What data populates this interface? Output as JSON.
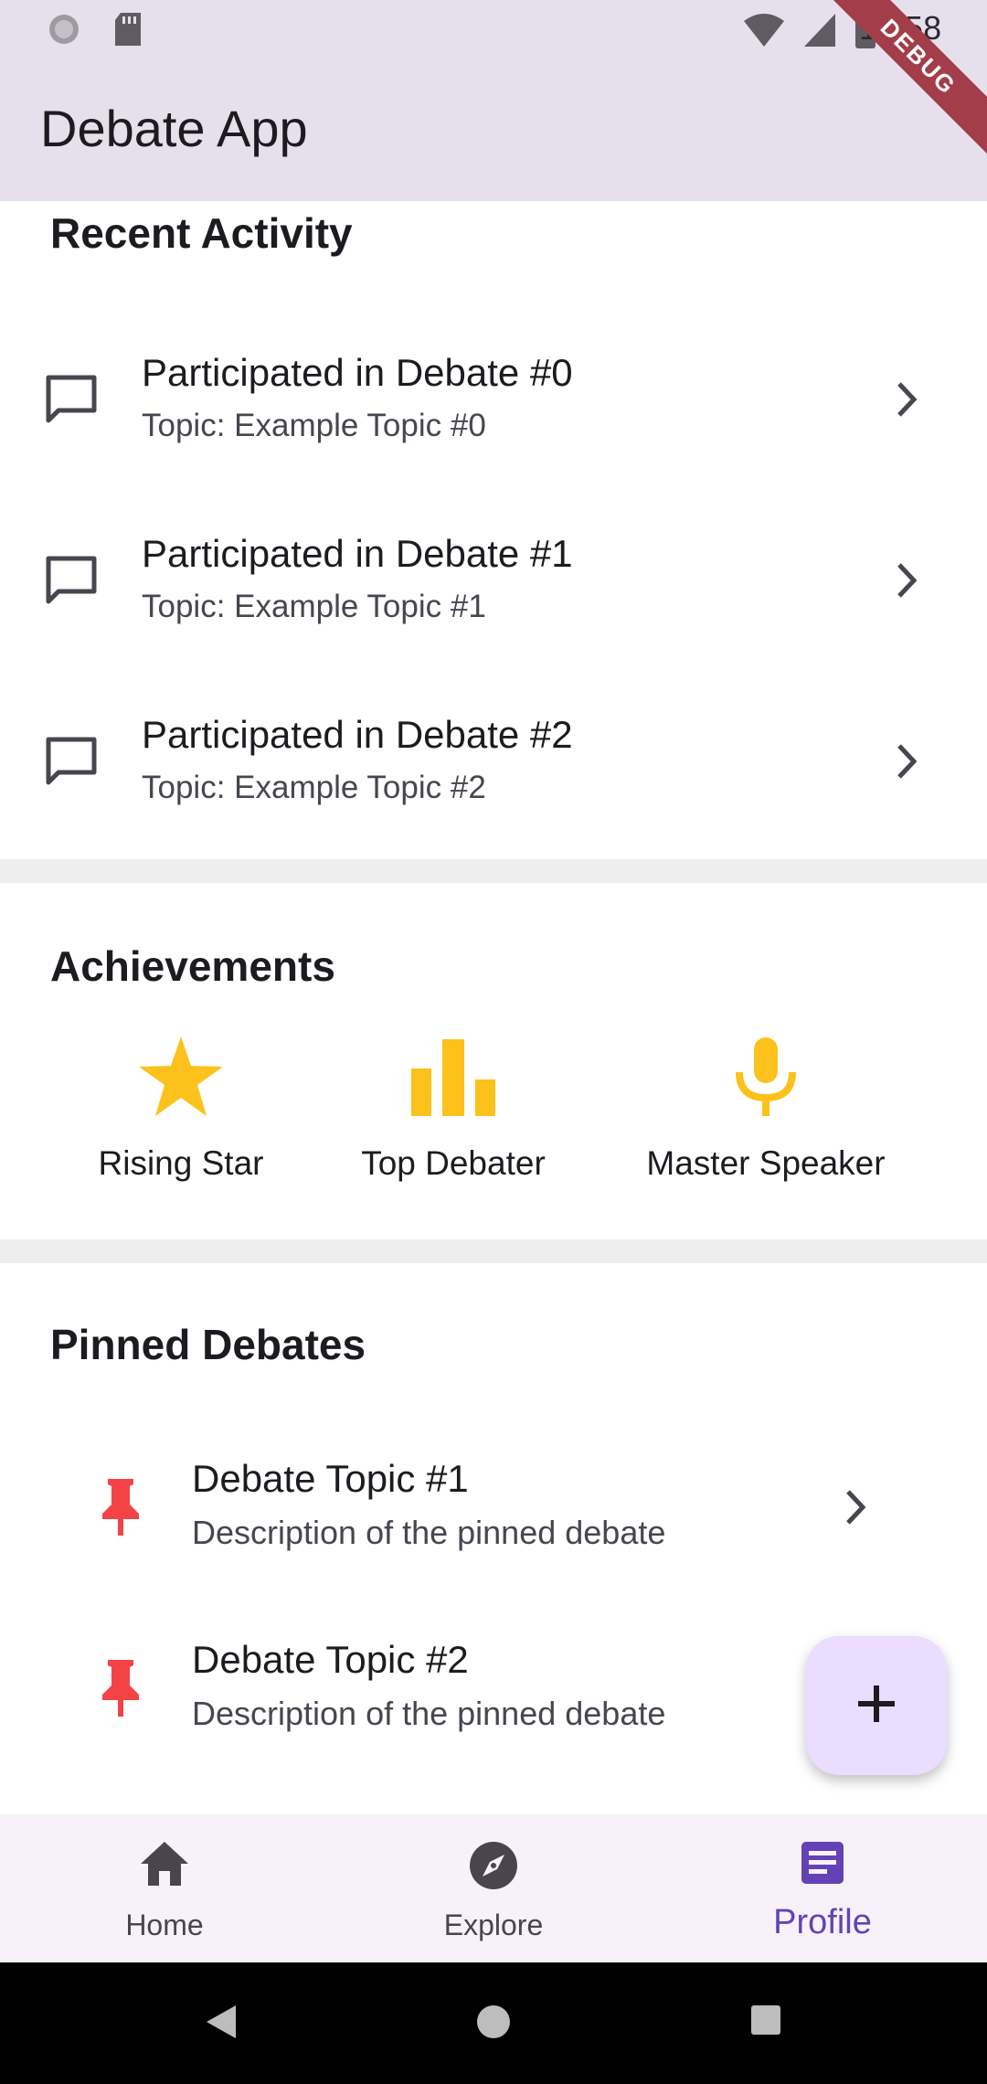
{
  "status_bar": {
    "time": "10:58"
  },
  "debug_banner": "DEBUG",
  "app_bar": {
    "title": "Debate App"
  },
  "recent_activity": {
    "title": "Recent Activity",
    "items": [
      {
        "title": "Participated in Debate #0",
        "subtitle": "Topic: Example Topic #0"
      },
      {
        "title": "Participated in Debate #1",
        "subtitle": "Topic: Example Topic #1"
      },
      {
        "title": "Participated in Debate #2",
        "subtitle": "Topic: Example Topic #2"
      }
    ]
  },
  "achievements": {
    "title": "Achievements",
    "items": [
      {
        "label": "Rising Star",
        "icon": "star-icon"
      },
      {
        "label": "Top Debater",
        "icon": "bar-chart-icon"
      },
      {
        "label": "Master Speaker",
        "icon": "mic-icon"
      }
    ]
  },
  "pinned_debates": {
    "title": "Pinned Debates",
    "items": [
      {
        "title": "Debate Topic #1",
        "subtitle": "Description of the pinned debate"
      },
      {
        "title": "Debate Topic #2",
        "subtitle": "Description of the pinned debate"
      }
    ]
  },
  "fab": {
    "icon": "add-icon"
  },
  "bottom_nav": {
    "items": [
      {
        "label": "Home",
        "icon": "home-icon",
        "active": false
      },
      {
        "label": "Explore",
        "icon": "explore-icon",
        "active": false
      },
      {
        "label": "Profile",
        "icon": "article-icon",
        "active": true
      }
    ]
  },
  "colors": {
    "app_bar": "#e6e0ec",
    "achievement_icon": "#fcc21b",
    "pin_icon": "#f44347",
    "fab": "#eaddff",
    "nav_active": "#6442b6",
    "nav_background": "#f7f2fa"
  }
}
